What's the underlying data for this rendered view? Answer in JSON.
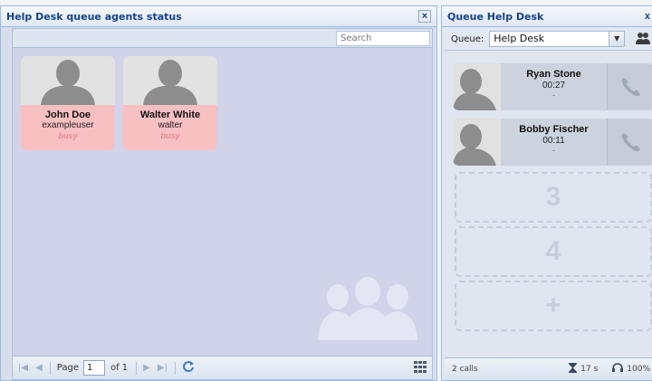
{
  "left_panel": {
    "title": "Help Desk queue agents status",
    "close": "×",
    "search_placeholder": "Search",
    "agents": [
      {
        "name": "John Doe",
        "username": "exampleuser",
        "status": "busy"
      },
      {
        "name": "Walter White",
        "username": "walter",
        "status": "busy"
      }
    ],
    "pager": {
      "page_label": "Page",
      "page_value": "1",
      "of_label": "of 1"
    }
  },
  "right_panel": {
    "title": "Queue Help Desk",
    "close": "x",
    "queue_label": "Queue:",
    "queue_value": "Help Desk",
    "calls": [
      {
        "name": "Ryan Stone",
        "time": "00:27",
        "extra": "-"
      },
      {
        "name": "Bobby Fischer",
        "time": "00:11",
        "extra": "-"
      }
    ],
    "slots": [
      "3",
      "4",
      "+"
    ],
    "status": {
      "calls_count": "2 calls",
      "wait": "17 s",
      "load": "100%"
    }
  },
  "colors": {
    "busy_bg": "#f9c0c2",
    "header_text": "#15428b"
  },
  "icons": [
    "close-icon",
    "user-silhouette-icon",
    "phone-icon",
    "group-icon",
    "refresh-icon",
    "grid-icon",
    "hourglass-icon",
    "agents-icon",
    "headset-icon"
  ]
}
